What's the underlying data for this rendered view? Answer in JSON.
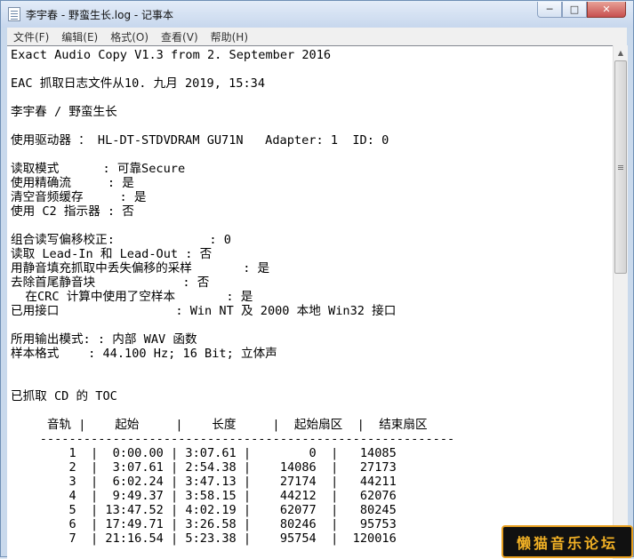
{
  "window": {
    "title": "李宇春 - 野蛮生长.log - 记事本",
    "buttons": {
      "minimize": "─",
      "maximize": "□",
      "close": "✕"
    }
  },
  "menu": [
    "文件(F)",
    "编辑(E)",
    "格式(O)",
    "查看(V)",
    "帮助(H)"
  ],
  "document": {
    "text": "Exact Audio Copy V1.3 from 2. September 2016\n\nEAC 抓取日志文件从10. 九月 2019, 15:34\n\n李宇春 / 野蛮生长\n\n使用驱动器 ： HL-DT-STDVDRAM GU71N   Adapter: 1  ID: 0\n\n读取模式      : 可靠Secure\n使用精确流     : 是\n清空音频缓存     : 是\n使用 C2 指示器 : 否\n\n组合读写偏移校正:             : 0\n读取 Lead-In 和 Lead-Out : 否\n用静音填充抓取中丢失偏移的采样       : 是\n去除首尾静音块            : 否\n  在CRC 计算中使用了空样本       : 是\n已用接口                : Win NT 及 2000 本地 Win32 接口\n\n所用输出模式: : 内部 WAV 函数\n样本格式    : 44.100 Hz; 16 Bit; 立体声\n\n\n已抓取 CD 的 TOC\n\n     音轨 |    起始     |    长度     |  起始扇区  |  结束扇区\n    ---------------------------------------------------------\n        1  |  0:00.00 | 3:07.61 |        0  |   14085\n        2  |  3:07.61 | 2:54.38 |    14086  |   27173\n        3  |  6:02.24 | 3:47.13 |    27174  |   44211\n        4  |  9:49.37 | 3:58.15 |    44212  |   62076\n        5  | 13:47.52 | 4:02.19 |    62077  |   80245\n        6  | 17:49.71 | 3:26.58 |    80246  |   95753\n        7  | 21:16.54 | 5:23.38 |    95754  |  120016"
  },
  "scrollbar": {
    "up_arrow": "▲",
    "down_arrow": "▼"
  },
  "watermark": "懒猫音乐论坛"
}
